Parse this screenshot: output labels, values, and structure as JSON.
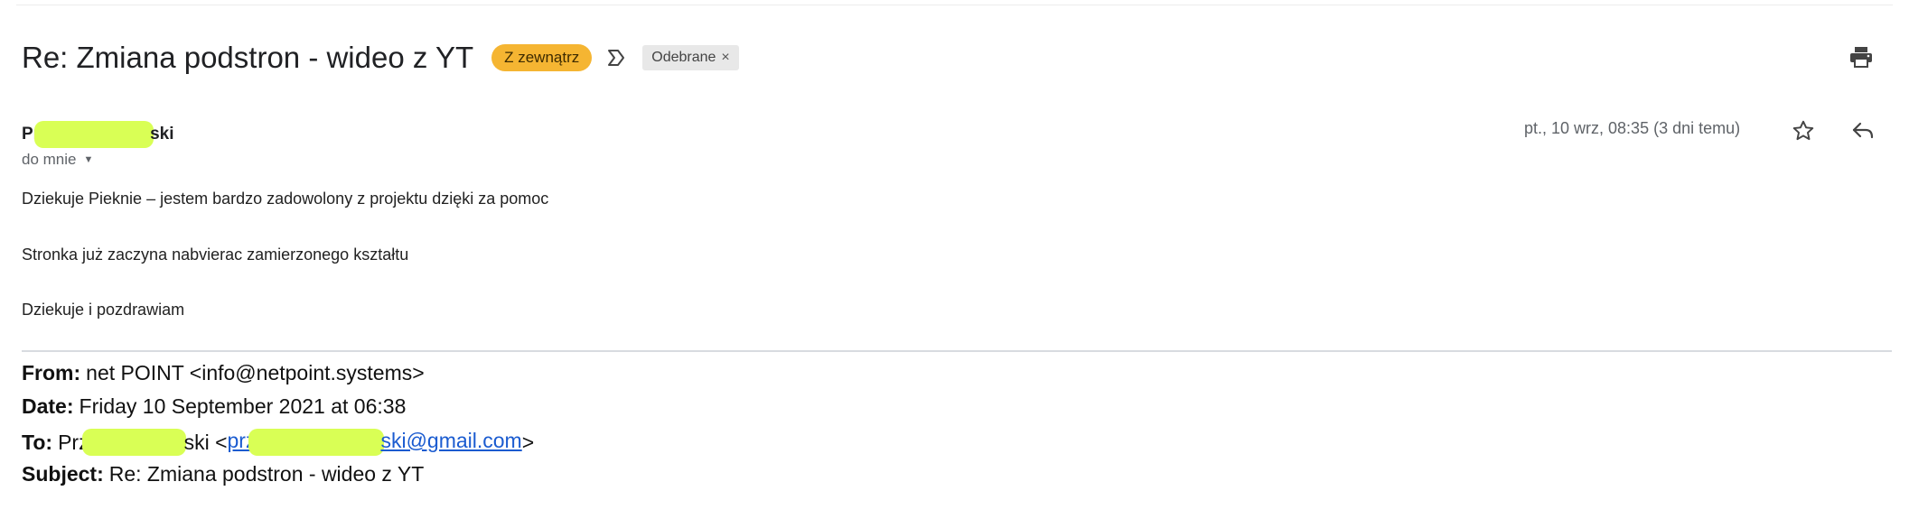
{
  "header": {
    "subject": "Re: Zmiana podstron - wideo z YT",
    "label_external": "Z zewnątrz",
    "important_icon": "important-marker-icon",
    "label_inbox": "Odebrane",
    "label_remove": "×",
    "print_icon": "print-icon"
  },
  "message": {
    "sender_prefix": "Pr",
    "sender_suffix": "ski",
    "recipient": "do mnie",
    "date": "pt., 10 wrz, 08:35 (3 dni temu)",
    "star_icon": "star-icon",
    "reply_icon": "reply-icon",
    "body": [
      "Dziekuje Pieknie – jestem bardzo zadowolony z projektu dzięki za pomoc",
      "Stronka już zaczyna nabvierac zamierzonego kształtu",
      "Dziekuje i pozdrawiam"
    ]
  },
  "quoted": {
    "from_label": "From:",
    "from_value": "net POINT <info@netpoint.systems>",
    "date_label": "Date:",
    "date_value": "Friday 10 September 2021 at 06:38",
    "to_label": "To:",
    "to_name_prefix": "Prz",
    "to_name_suffix": "ski <",
    "to_email_prefix": "prz",
    "to_email_suffix": "ski@gmail.com",
    "to_close": ">",
    "subject_label": "Subject:",
    "subject_value": "Re: Zmiana podstron - wideo z YT"
  },
  "colors": {
    "label_external_bg": "#f5b532",
    "label_inbox_bg": "#e8e8e8",
    "redaction": "#d9ff55",
    "link": "#1a5bd0"
  }
}
